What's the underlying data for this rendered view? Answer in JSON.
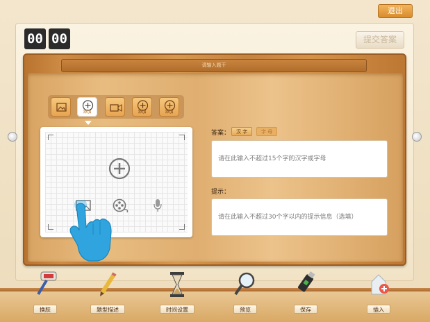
{
  "header": {
    "exit_label": "退出",
    "timer_minutes": "00",
    "timer_seconds": "00",
    "submit_label": "提交答案"
  },
  "board": {
    "title_placeholder": "请输入题干"
  },
  "media_bar": {
    "buttons": [
      {
        "icon": "image-icon",
        "label": ""
      },
      {
        "icon": "plus-circle-icon",
        "label": "添加"
      },
      {
        "icon": "video-icon",
        "label": ""
      },
      {
        "icon": "plus-circle-icon",
        "label": "添加"
      },
      {
        "icon": "plus-circle-icon",
        "label": "添加"
      }
    ]
  },
  "editor": {
    "add_icon": "plus-circle-icon",
    "options": [
      "image-icon",
      "film-reel-icon",
      "microphone-icon"
    ],
    "hint_icon": "pointing-hand-icon"
  },
  "answer": {
    "label": "答案：",
    "tab_hanzi": "汉 字",
    "tab_letters": "字 母",
    "placeholder": "请在此输入不超过15个字的汉字或字母"
  },
  "hint": {
    "label": "提示：",
    "placeholder": "请在此输入不超过30个字以内的提示信息（选填）"
  },
  "toolbar": {
    "items": [
      {
        "icon": "paint-roller-icon",
        "label": "换肤"
      },
      {
        "icon": "pencil-icon",
        "label": "题型描述"
      },
      {
        "icon": "hourglass-icon",
        "label": "时间设置"
      },
      {
        "icon": "magnifier-icon",
        "label": "预览"
      },
      {
        "icon": "usb-drive-icon",
        "label": "保存"
      },
      {
        "icon": "insert-icon",
        "label": "插入"
      }
    ]
  },
  "colors": {
    "accent_orange": "#e7a452",
    "wood": "#cd8b45",
    "timer_bg": "#2b2b2b",
    "hand_blue": "#2fa4de"
  }
}
